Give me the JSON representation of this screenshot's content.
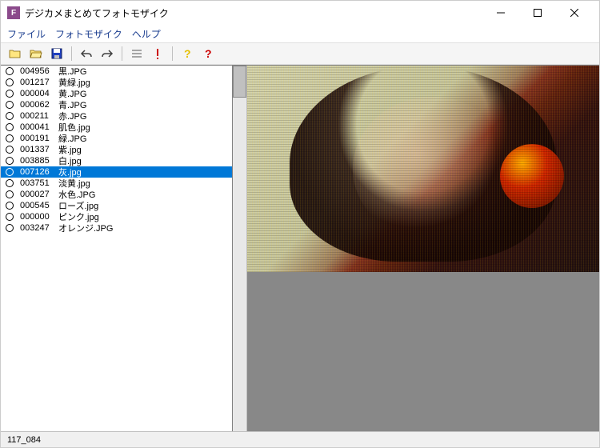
{
  "title": "デジカメまとめてフォトモザイク",
  "menu": {
    "file": "ファイル",
    "photomosaic": "フォトモザイク",
    "help": "ヘルプ"
  },
  "files": [
    {
      "num": "004956",
      "name": "黒.JPG"
    },
    {
      "num": "001217",
      "name": "黄緑.jpg"
    },
    {
      "num": "000004",
      "name": "黄.JPG"
    },
    {
      "num": "000062",
      "name": "青.JPG"
    },
    {
      "num": "000211",
      "name": "赤.JPG"
    },
    {
      "num": "000041",
      "name": "肌色.jpg"
    },
    {
      "num": "000191",
      "name": "緑.JPG"
    },
    {
      "num": "001337",
      "name": "紫.jpg"
    },
    {
      "num": "003885",
      "name": "白.jpg"
    },
    {
      "num": "007126",
      "name": "灰.jpg",
      "selected": true
    },
    {
      "num": "003751",
      "name": "淡黄.jpg"
    },
    {
      "num": "000027",
      "name": "水色.JPG"
    },
    {
      "num": "000545",
      "name": "ローズ.jpg"
    },
    {
      "num": "000000",
      "name": "ピンク.jpg"
    },
    {
      "num": "003247",
      "name": "オレンジ.JPG"
    }
  ],
  "status": "117_084"
}
